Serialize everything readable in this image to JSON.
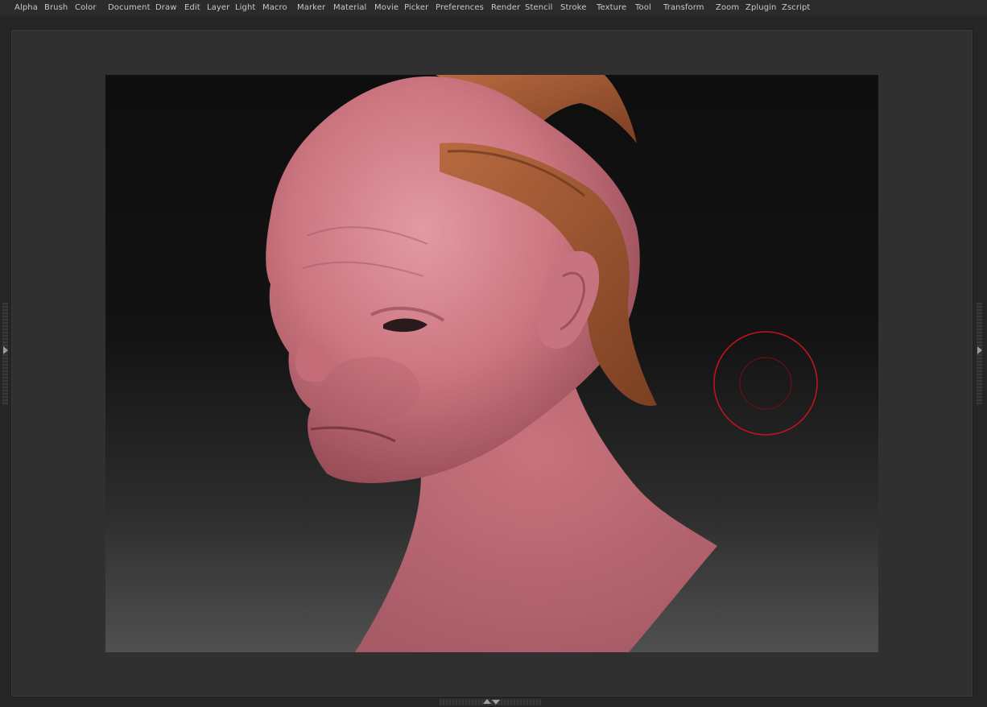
{
  "menu": {
    "items": [
      {
        "label": "Alpha"
      },
      {
        "label": "Brush"
      },
      {
        "label": "Color"
      },
      {
        "label": "Document"
      },
      {
        "label": "Draw"
      },
      {
        "label": "Edit"
      },
      {
        "label": "Layer"
      },
      {
        "label": "Light"
      },
      {
        "label": "Macro"
      },
      {
        "label": "Marker"
      },
      {
        "label": "Material"
      },
      {
        "label": "Movie"
      },
      {
        "label": "Picker"
      },
      {
        "label": "Preferences"
      },
      {
        "label": "Render"
      },
      {
        "label": "Stencil"
      },
      {
        "label": "Stroke"
      },
      {
        "label": "Texture"
      },
      {
        "label": "Tool"
      },
      {
        "label": "Transform"
      },
      {
        "label": "Zoom"
      },
      {
        "label": "Zplugin"
      },
      {
        "label": "Zscript"
      }
    ]
  },
  "colors": {
    "brush_cursor": "#c0141c",
    "skin": "#d07c86",
    "horn": "#a25a35",
    "menu_text": "#c9c9c9"
  },
  "icons": {
    "brush_cursor": "brush-cursor-icon",
    "left_tray": "chevron-right-icon",
    "right_tray": "chevron-right-icon",
    "bottom_tray_up": "triangle-up-icon",
    "bottom_tray_down": "triangle-down-icon"
  }
}
